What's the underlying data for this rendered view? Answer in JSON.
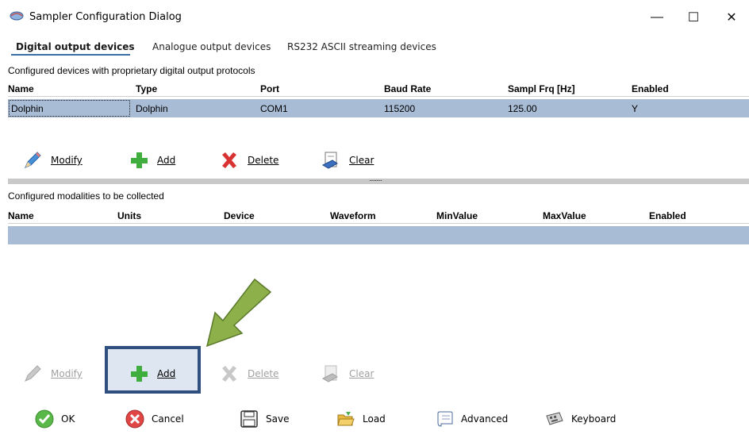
{
  "window": {
    "title": "Sampler Configuration Dialog",
    "controls": {
      "minimize": "—",
      "maximize": "☐",
      "close": "✕"
    }
  },
  "tabs": [
    {
      "label": "Digital output devices",
      "active": true
    },
    {
      "label": "Analogue output devices",
      "active": false
    },
    {
      "label": "RS232 ASCII streaming devices",
      "active": false
    }
  ],
  "devices_section": {
    "label": "Configured devices with proprietary digital output protocols",
    "columns": [
      "Name",
      "Type",
      "Port",
      "Baud Rate",
      "Sampl Frq [Hz]",
      "Enabled"
    ],
    "rows": [
      {
        "name": "Dolphin",
        "type": "Dolphin",
        "port": "COM1",
        "baud": "115200",
        "freq": "125.00",
        "enabled": "Y"
      }
    ],
    "toolbar": {
      "modify": "Modify",
      "add": "Add",
      "delete": "Delete",
      "clear": "Clear"
    }
  },
  "splitter": {
    "grip": "........."
  },
  "modalities_section": {
    "label": "Configured modalities to be collected",
    "columns": [
      "Name",
      "Units",
      "Device",
      "Waveform",
      "MinValue",
      "MaxValue",
      "Enabled"
    ],
    "toolbar": {
      "modify": "Modify",
      "add": "Add",
      "delete": "Delete",
      "clear": "Clear"
    }
  },
  "bottom_bar": {
    "ok": "OK",
    "cancel": "Cancel",
    "save": "Save",
    "load": "Load",
    "advanced": "Advanced",
    "keyboard": "Keyboard"
  },
  "colors": {
    "selected_row": "#a8bcd6",
    "highlight_border": "#2f4f7f",
    "arrow": "#8db04a"
  }
}
